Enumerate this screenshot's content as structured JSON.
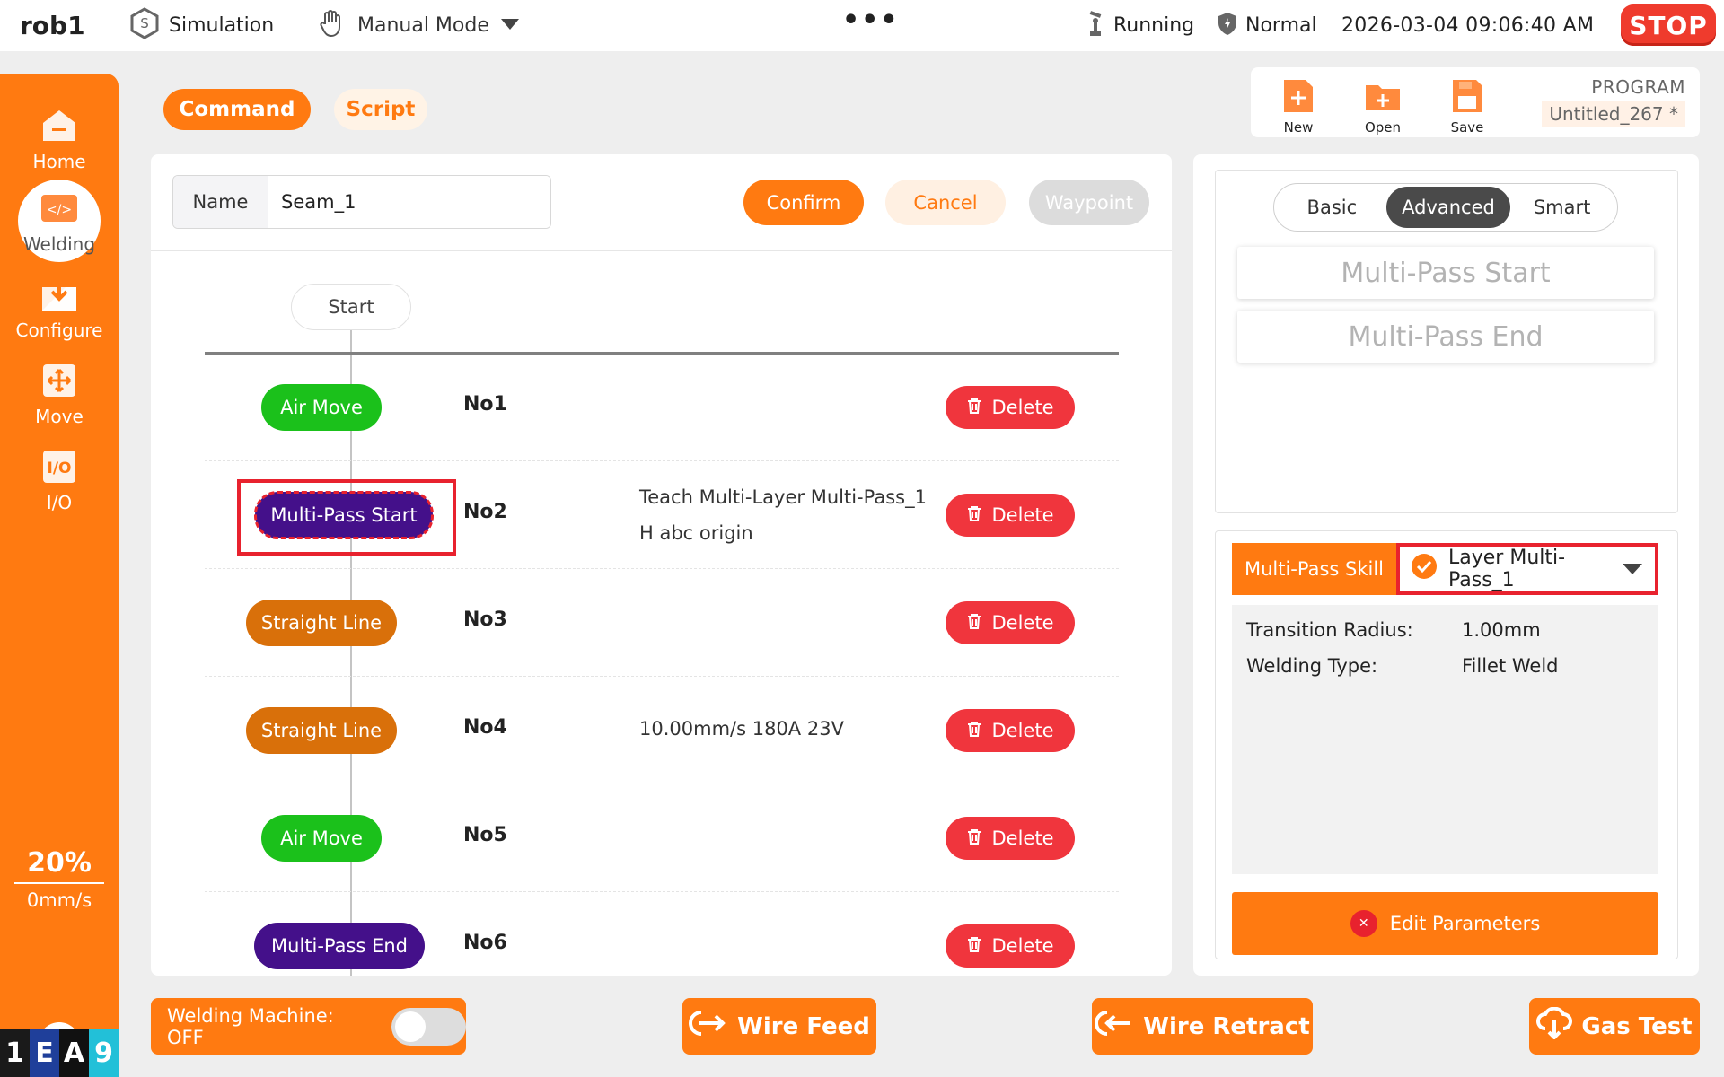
{
  "topbar": {
    "robot": "rob1",
    "simulation": "Simulation",
    "mode": "Manual Mode",
    "dots": "•••",
    "running": "Running",
    "normal": "Normal",
    "datetime": "2026-03-04 09:06:40 AM",
    "stop": "STOP"
  },
  "sidebar": {
    "items": [
      {
        "label": "Home",
        "icon": "home-icon"
      },
      {
        "label": "Welding",
        "icon": "code-icon",
        "active": true
      },
      {
        "label": "Configure",
        "icon": "download-icon"
      },
      {
        "label": "Move",
        "icon": "move-icon"
      },
      {
        "label": "I/O",
        "icon": "io-icon"
      }
    ],
    "speed_percent": "20%",
    "speed_mms": "0mm/s",
    "brand": [
      "1",
      "E",
      "A",
      "9"
    ]
  },
  "tabs": {
    "command": "Command",
    "script": "Script"
  },
  "program": {
    "new": "New",
    "open": "Open",
    "save": "Save",
    "label": "PROGRAM",
    "name": "Untitled_267 *"
  },
  "editor": {
    "name_label": "Name",
    "name_value": "Seam_1",
    "confirm": "Confirm",
    "cancel": "Cancel",
    "waypoint": "Waypoint",
    "start": "Start",
    "delete_label": "Delete",
    "rows": [
      {
        "cmd": "Air Move",
        "no": "No1",
        "desc1": "",
        "desc2": ""
      },
      {
        "cmd": "Multi-Pass Start",
        "no": "No2",
        "desc1": "Teach Multi-Layer Multi-Pass_1",
        "desc2": "H abc origin"
      },
      {
        "cmd": "Straight Line",
        "no": "No3",
        "desc1": "",
        "desc2": ""
      },
      {
        "cmd": "Straight Line",
        "no": "No4",
        "desc1": "10.00mm/s 180A 23V",
        "desc2": ""
      },
      {
        "cmd": "Air Move",
        "no": "No5",
        "desc1": "",
        "desc2": ""
      },
      {
        "cmd": "Multi-Pass End",
        "no": "No6",
        "desc1": "",
        "desc2": ""
      }
    ]
  },
  "right": {
    "seg_basic": "Basic",
    "seg_advanced": "Advanced",
    "seg_smart": "Smart",
    "skill_start": "Multi-Pass Start",
    "skill_end": "Multi-Pass End",
    "ms_skill": "Multi-Pass Skill",
    "ms_selected": "Layer Multi-Pass_1",
    "transition_label": "Transition Radius:",
    "transition_value": "1.00mm",
    "type_label": "Welding Type:",
    "type_value": "Fillet Weld",
    "edit": "Edit Parameters"
  },
  "bottom": {
    "machine": "Welding Machine: OFF",
    "feed": "Wire Feed",
    "retract": "Wire Retract",
    "gas": "Gas Test"
  },
  "colors": {
    "accent": "#ff7a11",
    "stop": "#ef3b2d",
    "air_move": "#1bc11b",
    "straight_line": "#d9700a",
    "multi_pass": "#44108a",
    "delete": "#f0353d"
  }
}
